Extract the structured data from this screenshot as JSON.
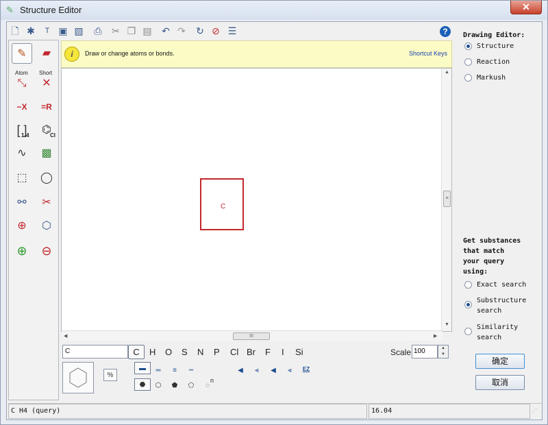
{
  "window": {
    "title": "Structure Editor",
    "close_label": "✕"
  },
  "toolbar": {
    "items": [
      "new-doc-icon",
      "template-icon",
      "text-icon",
      "save-icon",
      "export-icon",
      "print-icon",
      "cut-icon",
      "copy-icon",
      "paste-icon",
      "undo-icon",
      "redo-icon",
      "refresh-icon",
      "clear-icon",
      "list-icon"
    ],
    "help_label": "?"
  },
  "left_tools": {
    "atom_caption": "Atom",
    "short_caption": "Short",
    "remove_x_label": "−X",
    "remove_r_label": "=R",
    "bracket_caption": "1-4",
    "cl_caption": "Cl"
  },
  "hint": {
    "text": "Draw or change atoms or bonds.",
    "shortcut_label": "Shortcut Keys"
  },
  "canvas": {
    "atom_symbol": "C"
  },
  "bottom": {
    "formula_value": "C",
    "elements": [
      "C",
      "H",
      "O",
      "S",
      "N",
      "P",
      "Cl",
      "Br",
      "F",
      "I",
      "Si"
    ],
    "selected_element": "C",
    "scale_label": "Scale",
    "scale_value": "100",
    "ez_label": "EZ",
    "ring_n_label": "n"
  },
  "right_panel": {
    "drawing_editor_heading": "Drawing Editor:",
    "editor_modes": [
      "Structure",
      "Reaction",
      "Markush"
    ],
    "selected_mode": "Structure",
    "query_heading_lines": [
      "Get substances",
      "that match",
      "your query",
      "using:"
    ],
    "search_options": [
      {
        "label_lines": [
          "Exact search"
        ],
        "selected": false
      },
      {
        "label_lines": [
          "Substructure",
          "search"
        ],
        "selected": true
      },
      {
        "label_lines": [
          "Similarity",
          "search"
        ],
        "selected": false
      }
    ],
    "ok_label": "确定",
    "cancel_label": "取消"
  },
  "status": {
    "formula": "C H4 (query)",
    "mass": "16.04"
  },
  "colors": {
    "accent": "#1e4e92",
    "atom_box": "#c1272d",
    "hint_bg": "#fbfbc6"
  }
}
